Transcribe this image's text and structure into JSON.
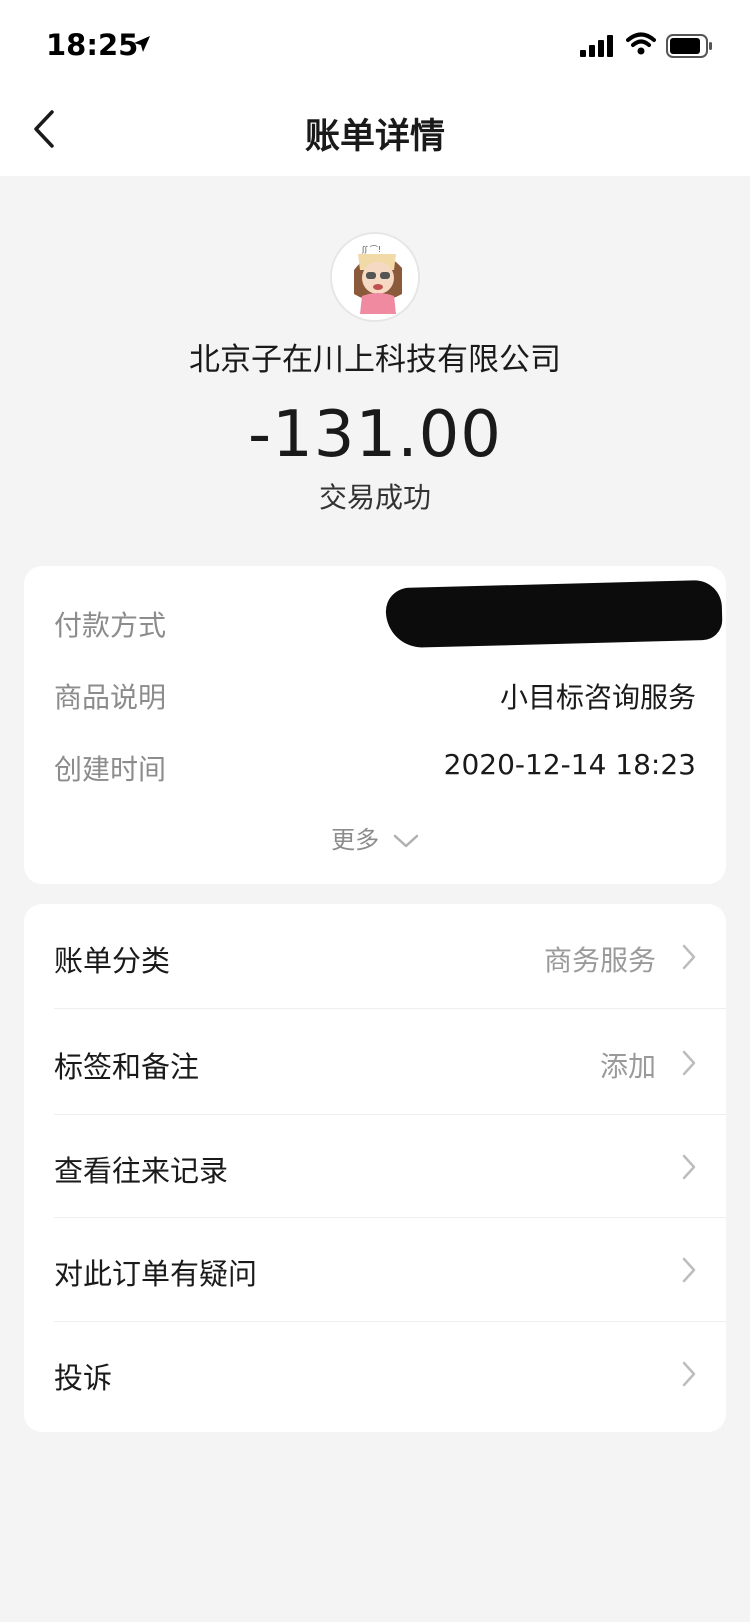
{
  "status_bar": {
    "time": "18:25"
  },
  "header": {
    "title": "账单详情"
  },
  "summary": {
    "merchant": "北京子在川上科技有限公司",
    "amount": "-131.00",
    "status": "交易成功"
  },
  "details": {
    "rows": [
      {
        "label": "付款方式",
        "value": ""
      },
      {
        "label": "商品说明",
        "value": "小目标咨询服务"
      },
      {
        "label": "创建时间",
        "value": "2020-12-14 18:23"
      }
    ],
    "more_label": "更多"
  },
  "menu": {
    "items": [
      {
        "label": "账单分类",
        "value": "商务服务"
      },
      {
        "label": "标签和备注",
        "value": "添加"
      },
      {
        "label": "查看往来记录",
        "value": ""
      },
      {
        "label": "对此订单有疑问",
        "value": ""
      },
      {
        "label": "投诉",
        "value": ""
      }
    ]
  },
  "colors": {
    "background": "#f4f4f4",
    "card": "#ffffff",
    "muted": "#8c8c8c"
  }
}
